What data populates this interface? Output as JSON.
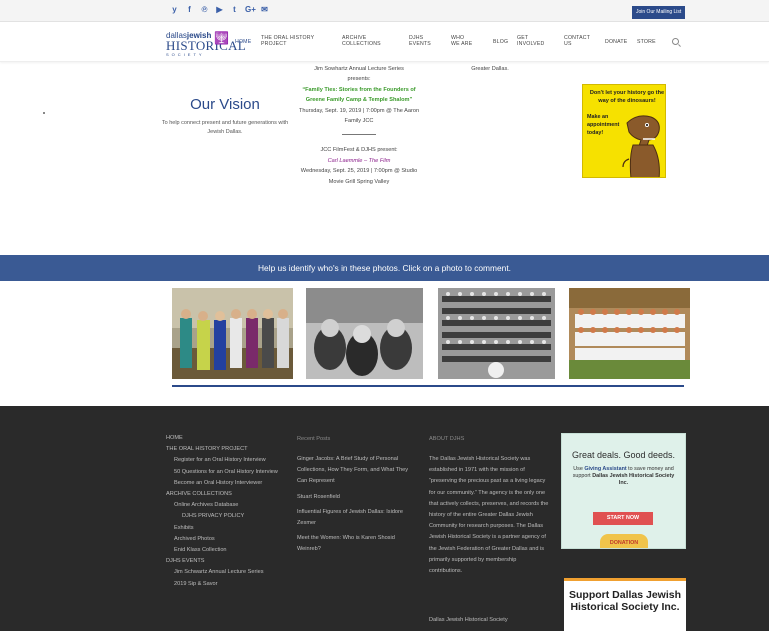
{
  "topbar": {
    "social_icons": [
      "twitter-icon",
      "facebook-icon",
      "pinterest-icon",
      "youtube-icon",
      "tumblr-icon",
      "google-plus-icon",
      "email-icon"
    ],
    "social_glyphs": [
      "y",
      "f",
      "℗",
      "▶",
      "t",
      "G+",
      "✉"
    ],
    "mailing_label": "Join Our Mailing List"
  },
  "logo": {
    "line1a": "dallas",
    "line1b": "jewish",
    "line2": "HISTORICAL",
    "line3": "SOCIETY"
  },
  "nav": {
    "home": "HOME",
    "oral": "THE ORAL HISTORY PROJECT",
    "archive": "ARCHIVE COLLECTIONS",
    "djhs": "DJHS EVENTS",
    "who": "WHO WE ARE",
    "blog": "BLOG",
    "get": "GET INVOLVED",
    "contact": "CONTACT US",
    "donate": "DONATE",
    "store": "STORE"
  },
  "vision": {
    "title": "Our Vision",
    "text": "To help connect present and future generations with Jewish Dallas."
  },
  "events": {
    "e1_l1": "Jim Sowhartz Annual Lecture Series",
    "e1_l2": "presents:",
    "e1_title": "“Family Ties: Stories from the Founders of Greene Family Camp & Temple Shalom”",
    "e1_when": "Thursday, Sept. 19, 2019 | 7:00pm @ The Aaron Family JCC",
    "e2_l1": "JCC FilmFest & DJHS present:",
    "e2_title": "Carl Laemmle – The Film",
    "e2_when": "Wednesday, Sept. 25, 2019 | 7:00pm @ Studio Movie Grill Spring Valley"
  },
  "side": {
    "greater": "Greater Dallas."
  },
  "dino": {
    "headline": "Don't let your history go the way of the dinosaurs!",
    "cta": "Make an appointment today!"
  },
  "banner": {
    "text": "Help us identify who's in these photos. Click on a photo to comment."
  },
  "footer": {
    "col1": {
      "items": [
        {
          "t": "HOME",
          "lvl": 0
        },
        {
          "t": "THE ORAL HISTORY PROJECT",
          "lvl": 0
        },
        {
          "t": "Register for an Oral History Interview",
          "lvl": 1
        },
        {
          "t": "50 Questions for an Oral History Interview",
          "lvl": 1
        },
        {
          "t": "Become an Oral History Interviewer",
          "lvl": 1
        },
        {
          "t": "ARCHIVE COLLECTIONS",
          "lvl": 0
        },
        {
          "t": "Online Archives Database",
          "lvl": 1
        },
        {
          "t": "DJHS PRIVACY POLICY",
          "lvl": 2
        },
        {
          "t": "Exhibits",
          "lvl": 1
        },
        {
          "t": "Archived Photos",
          "lvl": 1
        },
        {
          "t": "Enid Klass Collection",
          "lvl": 1
        },
        {
          "t": "DJHS EVENTS",
          "lvl": 0
        },
        {
          "t": "Jim Schwartz Annual Lecture Series",
          "lvl": 1
        },
        {
          "t": "2019 Sip & Savor",
          "lvl": 1
        }
      ]
    },
    "col2": {
      "heading": "Recent Posts",
      "posts": [
        "Ginger Jacobs: A Brief Study of Personal Collections, How They Form, and What They Can Represent",
        "Stuart Rosenfield",
        "Influential Figures of Jewish Dallas: Isidore Zesmer",
        "Meet the Women: Who is Karen Shosid Weinreb?"
      ]
    },
    "col3": {
      "heading": "ABOUT DJHS",
      "text": "The Dallas Jewish Historical Society was established in 1971 with the mission of “preserving the precious past as a living legacy for our community.” The agency is the only one that actively collects, preserves, and records the history of the entire Greater Dallas Jewish Community for research purposes. The Dallas Jewish Historical Society is a partner agency of the Jewish Federation of Greater Dallas and is primarily supported by membership contributions.",
      "address": "Dallas Jewish Historical Society"
    },
    "ad1": {
      "title": "Great deals. Good deeds.",
      "text_a": "Use ",
      "text_b": "Giving Assistant",
      "text_c": " to save money and support ",
      "text_d": "Dallas Jewish Historical Society Inc.",
      "button": "START NOW",
      "donation": "DONATION"
    },
    "ad2": {
      "text": "Support Dallas Jewish Historical Society Inc."
    }
  },
  "colors": {
    "accent": "#2b4a8a",
    "banner": "#3a5a94",
    "footer": "#2a2a2a",
    "green": "#3a9a2a",
    "purple": "#8a1e8a"
  }
}
